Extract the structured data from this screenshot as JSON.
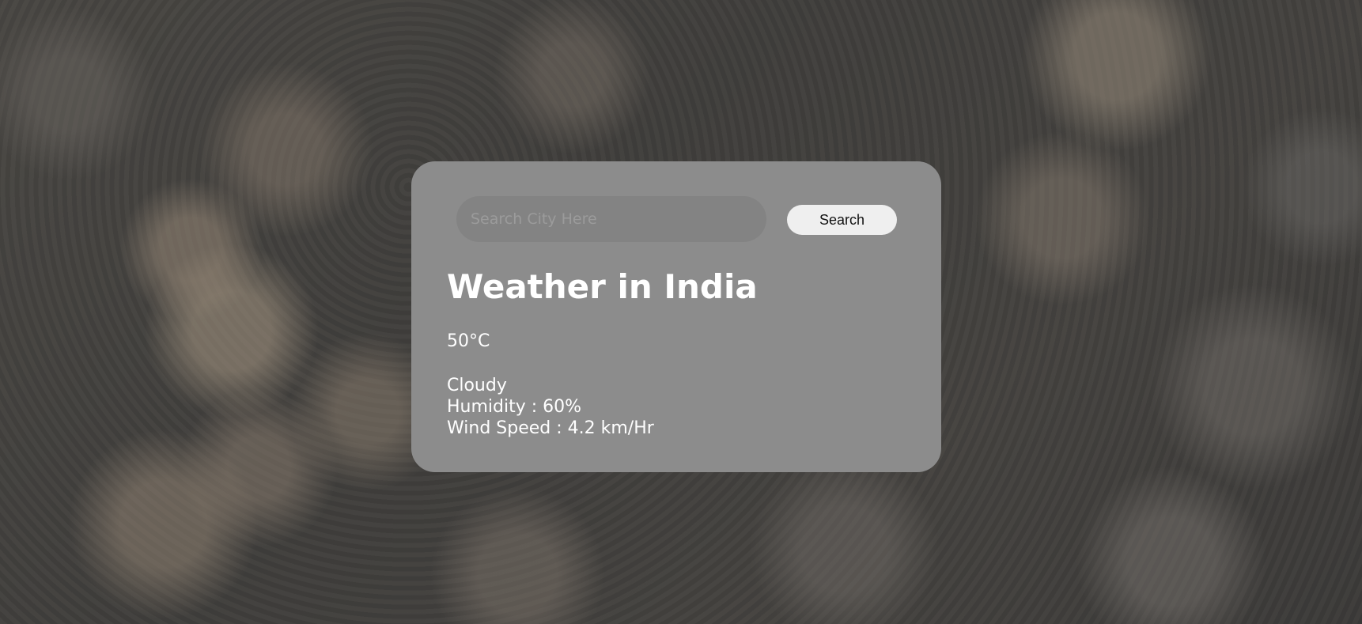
{
  "search": {
    "placeholder": "Search City Here",
    "value": "",
    "button_label": "Search"
  },
  "weather": {
    "title": "Weather in India",
    "temperature": "50°C",
    "condition": "Cloudy",
    "humidity": "Humidity : 60%",
    "wind_speed": "Wind Speed : 4.2 km/Hr"
  },
  "colors": {
    "card_background": "#8c8c8c",
    "input_background": "#838383",
    "button_background": "#efefef",
    "text": "#ffffff"
  }
}
